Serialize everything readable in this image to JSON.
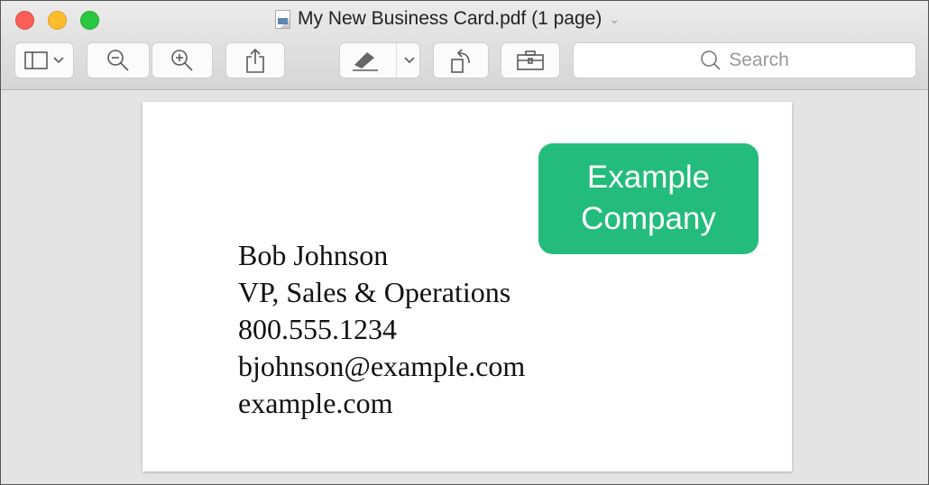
{
  "window": {
    "title": "My New Business Card.pdf (1 page)"
  },
  "toolbar": {
    "search_placeholder": "Search",
    "icons": [
      "sidebar-icon",
      "zoom-out-icon",
      "zoom-in-icon",
      "share-icon",
      "markup-icon",
      "rotate-icon",
      "toolbox-icon"
    ]
  },
  "card": {
    "company_line1": "Example",
    "company_line2": "Company",
    "company_color": "#24bc7c",
    "name": "Bob Johnson",
    "job_title": "VP, Sales & Operations",
    "phone": "800.555.1234",
    "email": "bjohnson@example.com",
    "website": "example.com"
  }
}
